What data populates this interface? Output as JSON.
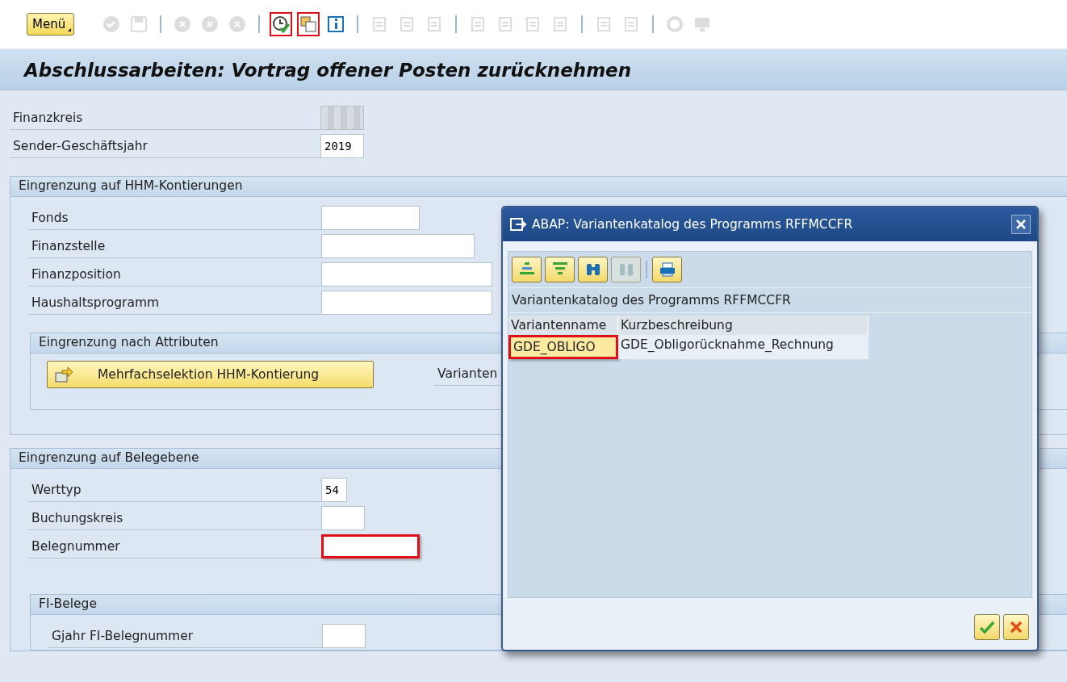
{
  "toolbar": {
    "menu_label": "Menü",
    "groups": [
      [
        {
          "highlighted": false,
          "disabled": true
        },
        {
          "highlighted": false,
          "disabled": true
        }
      ],
      [
        {
          "highlighted": false,
          "disabled": true
        },
        {
          "highlighted": false,
          "disabled": true
        },
        {
          "highlighted": false,
          "disabled": true
        }
      ],
      [
        {
          "highlighted": true,
          "disabled": false
        },
        {
          "highlighted": true,
          "disabled": false
        },
        {
          "highlighted": false,
          "disabled": false
        }
      ],
      [
        {
          "highlighted": false,
          "disabled": true
        },
        {
          "highlighted": false,
          "disabled": true
        },
        {
          "highlighted": false,
          "disabled": true
        }
      ],
      [
        {
          "highlighted": false,
          "disabled": true
        },
        {
          "highlighted": false,
          "disabled": true
        },
        {
          "highlighted": false,
          "disabled": true
        },
        {
          "highlighted": false,
          "disabled": true
        }
      ],
      [
        {
          "highlighted": false,
          "disabled": true
        },
        {
          "highlighted": false,
          "disabled": true
        }
      ],
      [
        {
          "highlighted": false,
          "disabled": true
        },
        {
          "highlighted": false,
          "disabled": true
        }
      ]
    ]
  },
  "title": "Abschlussarbeiten: Vortrag offener Posten zurücknehmen",
  "header_fields": [
    {
      "label": "Finanzkreis",
      "redacted": true,
      "highlighted": false
    },
    {
      "label": "Sender-Geschäftsjahr",
      "value": "2019",
      "redacted": false,
      "highlighted": false
    }
  ],
  "sections": [
    {
      "title": "Eingrenzung auf HHM-Kontierungen",
      "fields": [
        {
          "label": "Fonds",
          "redacted": false,
          "highlighted": false
        },
        {
          "label": "Finanzstelle",
          "redacted": false,
          "highlighted": false
        },
        {
          "label": "Finanzposition",
          "redacted": false,
          "highlighted": false
        },
        {
          "label": "Haushaltsprogramm",
          "redacted": false,
          "highlighted": false
        }
      ],
      "subsection": {
        "title": "Eingrenzung nach Attributen",
        "button": "Mehrfachselektion HHM-Kontierung",
        "side_label": "Varianten"
      }
    },
    {
      "title": "Eingrenzung auf Belegebene",
      "fields": [
        {
          "label": "Werttyp",
          "value": "54",
          "redacted": false,
          "highlighted": false
        },
        {
          "label": "Buchungskreis",
          "redacted": false,
          "highlighted": false
        },
        {
          "label": "Belegnummer",
          "redacted": false,
          "highlighted": true
        }
      ],
      "subsection": {
        "title": "FI-Belege",
        "fields": [
          {
            "label": "Gjahr FI-Belegnummer",
            "redacted": false,
            "highlighted": false
          }
        ]
      }
    }
  ],
  "dialog": {
    "title": "ABAP: Variantenkatalog des Programms RFFMCCFR",
    "tools": [
      {
        "disabled": false
      },
      {
        "disabled": false
      },
      {
        "disabled": false
      },
      {
        "disabled": true
      },
      {
        "disabled": false
      }
    ],
    "list_title": "Variantenkatalog des Programms RFFMCCFR",
    "columns": [
      "Variantenname",
      "Kurzbeschreibung"
    ],
    "rows": [
      {
        "cells": [
          "GDE_OBLIGO",
          "GDE_Obligorücknahme_Rechnung"
        ],
        "selected": true,
        "highlighted": true
      }
    ]
  }
}
